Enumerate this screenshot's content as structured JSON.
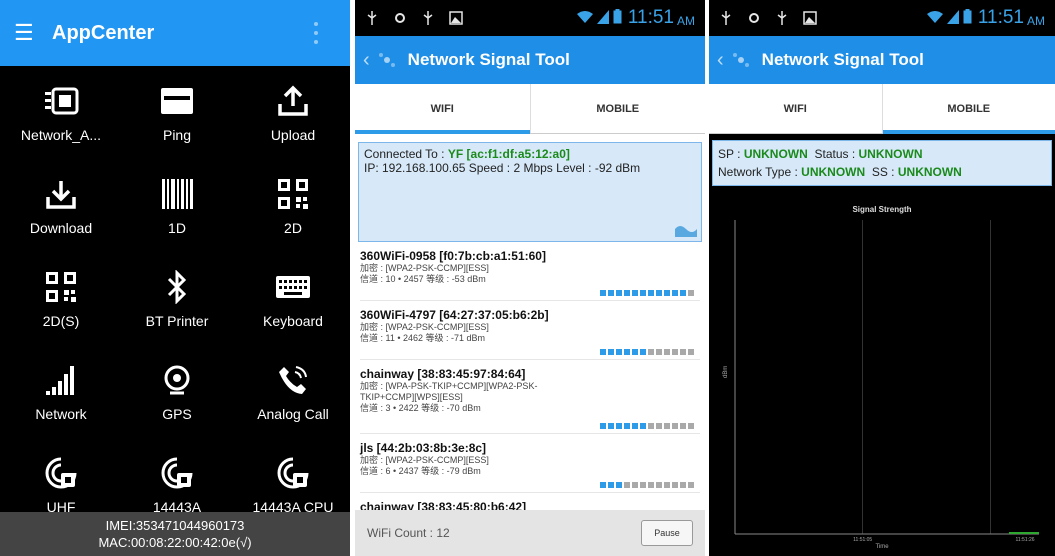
{
  "appcenter": {
    "title": "AppCenter",
    "tiles": [
      {
        "label": "Network_A...",
        "icon": "network-analyzer-icon"
      },
      {
        "label": "Ping",
        "icon": "ping-icon"
      },
      {
        "label": "Upload",
        "icon": "upload-icon"
      },
      {
        "label": "Download",
        "icon": "download-icon"
      },
      {
        "label": "1D",
        "icon": "barcode-1d-icon"
      },
      {
        "label": "2D",
        "icon": "qr-code-icon"
      },
      {
        "label": "2D(S)",
        "icon": "qr-code-icon"
      },
      {
        "label": "BT Printer",
        "icon": "bluetooth-icon"
      },
      {
        "label": "Keyboard",
        "icon": "keyboard-icon"
      },
      {
        "label": "Network",
        "icon": "signal-bars-icon"
      },
      {
        "label": "GPS",
        "icon": "gps-icon"
      },
      {
        "label": "Analog Call",
        "icon": "phone-call-icon"
      },
      {
        "label": "UHF",
        "icon": "rfid-icon"
      },
      {
        "label": "14443A",
        "icon": "rfid-icon"
      },
      {
        "label": "14443A CPU",
        "icon": "rfid-icon"
      }
    ],
    "imei": "IMEI:353471044960173",
    "mac": "MAC:00:08:22:00:42:0e(√)"
  },
  "status": {
    "time": "11:51",
    "ampm": "AM"
  },
  "tool": {
    "title": "Network Signal Tool",
    "tab_wifi": "WIFI",
    "tab_mobile": "MOBILE"
  },
  "wifi": {
    "connected_label": "Connected To :",
    "connected_value": "YF [ac:f1:df:a5:12:a0]",
    "ip_line": "IP: 192.168.100.65  Speed : 2 Mbps  Level : -92 dBm",
    "networks": [
      {
        "name": "360WiFi-0958 [f0:7b:cb:a1:51:60]",
        "l1": "加密 : [WPA2-PSK-CCMP][ESS]",
        "l2": "信道 : 10 • 2457   等级 : -53 dBm",
        "strength": 0.9
      },
      {
        "name": "360WiFi-4797 [64:27:37:05:b6:2b]",
        "l1": "加密 : [WPA2-PSK-CCMP][ESS]",
        "l2": "信道 : 11 • 2462   等级 : -71 dBm",
        "strength": 0.5
      },
      {
        "name": "chainway [38:83:45:97:84:64]",
        "l1": "加密 : [WPA-PSK-TKIP+CCMP][WPA2-PSK-",
        "l1b": "TKIP+CCMP][WPS][ESS]",
        "l2": "信道 : 3 • 2422   等级 : -70 dBm",
        "strength": 0.5
      },
      {
        "name": "jls [44:2b:03:8b:3e:8c]",
        "l1": "加密 : [WPA2-PSK-CCMP][ESS]",
        "l2": "信道 : 6 • 2437   等级 : -79 dBm",
        "strength": 0.25
      },
      {
        "name": "chainway [38:83:45:80:b6:42]"
      }
    ],
    "count": "WiFi Count : 12",
    "pause": "Pause"
  },
  "mobile": {
    "sp_label": "SP :",
    "sp_value": "UNKNOWN",
    "status_label": "Status :",
    "status_value": "UNKNOWN",
    "nettype_label": "Network Type :",
    "nettype_value": "UNKNOWN",
    "ss_label": "SS :",
    "ss_value": "UNKNOWN"
  },
  "chart_data": {
    "type": "line",
    "title": "Signal Strength",
    "xlabel": "Time",
    "ylabel": "dBm",
    "x_ticks": [
      "11:51:05",
      "11:51:26"
    ],
    "grid": "vertical",
    "series": [
      {
        "values": []
      }
    ],
    "color": "#2fa82f"
  }
}
